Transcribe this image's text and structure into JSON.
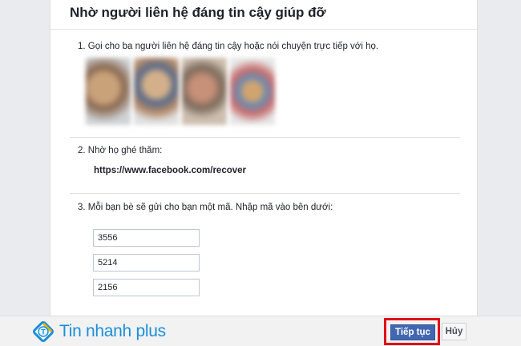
{
  "dialog": {
    "title": "Nhờ người liên hệ đáng tin cậy giúp đỡ",
    "step1": "1. Gọi cho ba người liên hệ đáng tin cậy hoặc nói chuyện trực tiếp với họ.",
    "step2": "2. Nhờ họ ghé thăm:",
    "recover_url": "https://www.facebook.com/recover",
    "step3": "3. Mỗi bạn bè sẽ gửi cho bạn một mã. Nhập mã vào bên dưới:",
    "codes": [
      "3556",
      "5214",
      "2156"
    ]
  },
  "footer": {
    "logo_text": "Tin nhanh plus",
    "continue_label": "Tiếp tục",
    "cancel_label": "Hủy"
  },
  "colors": {
    "primary_button": "#4267b2",
    "highlight_box": "#e0101a",
    "logo_blue": "#1a8fd8"
  }
}
